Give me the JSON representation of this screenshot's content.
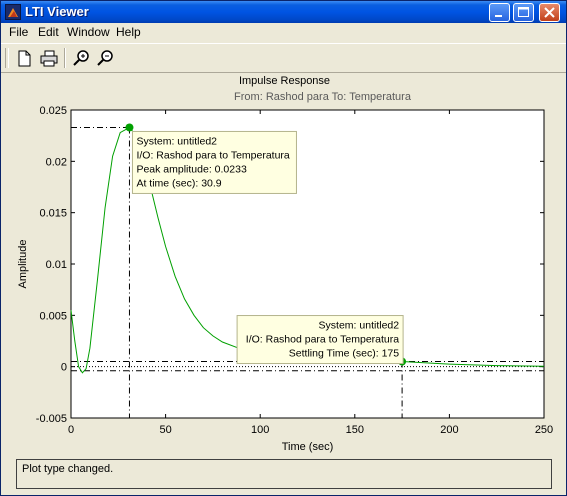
{
  "window": {
    "title": "LTI Viewer"
  },
  "menu": [
    "File",
    "Edit",
    "Window",
    "Help"
  ],
  "toolbar": {
    "icons": [
      "new-file-icon",
      "print-icon",
      "zoom-in-icon",
      "zoom-out-icon"
    ]
  },
  "plot": {
    "title": "Impulse Response",
    "subtitle": "From: Rashod para  To: Temperatura",
    "xlabel": "Time (sec)",
    "ylabel": "Amplitude",
    "xticks": [
      "0",
      "50",
      "100",
      "150",
      "200",
      "250"
    ],
    "yticks": [
      "-0.005",
      "0",
      "0.005",
      "0.01",
      "0.015",
      "0.02",
      "0.025"
    ]
  },
  "chart_data": {
    "type": "line",
    "title": "Impulse Response",
    "xlabel": "Time (sec)",
    "ylabel": "Amplitude",
    "xlim": [
      0,
      250
    ],
    "ylim": [
      -0.005,
      0.025
    ],
    "line_color": "#00a000",
    "series": [
      {
        "x": [
          0,
          2,
          4,
          6,
          8,
          10,
          14,
          18,
          22,
          26,
          30.9,
          34,
          38,
          42,
          46,
          50,
          55,
          60,
          65,
          70,
          75,
          80,
          90,
          100,
          110,
          120,
          130,
          140,
          150,
          160,
          175,
          190,
          200,
          225,
          250
        ],
        "y": [
          0.0055,
          0.0025,
          0.0,
          -0.0006,
          -0.0002,
          0.0018,
          0.0085,
          0.0155,
          0.0205,
          0.0228,
          0.0233,
          0.0226,
          0.0205,
          0.0175,
          0.0145,
          0.0117,
          0.0088,
          0.0066,
          0.005,
          0.0038,
          0.003,
          0.0024,
          0.0017,
          0.0013,
          0.0011,
          0.00095,
          0.00085,
          0.00075,
          0.00068,
          0.0006,
          0.0005,
          0.00035,
          0.00025,
          0.0001,
          4e-05
        ]
      }
    ],
    "annotations": [
      {
        "x": 30.9,
        "y": 0.0233,
        "lines": [
          "System: untitled2",
          "I/O: Rashod para to Temperatura",
          "Peak amplitude: 0.0233",
          "At time (sec): 30.9"
        ],
        "align": "left"
      },
      {
        "x": 175,
        "y": 0.0005,
        "lines": [
          "System: untitled2",
          "I/O: Rashod para to Temperatura",
          "Settling Time (sec): 175"
        ],
        "align": "right"
      }
    ],
    "settling_band": [
      -0.0004,
      0.0005
    ]
  },
  "status": {
    "text": "Plot type changed."
  }
}
